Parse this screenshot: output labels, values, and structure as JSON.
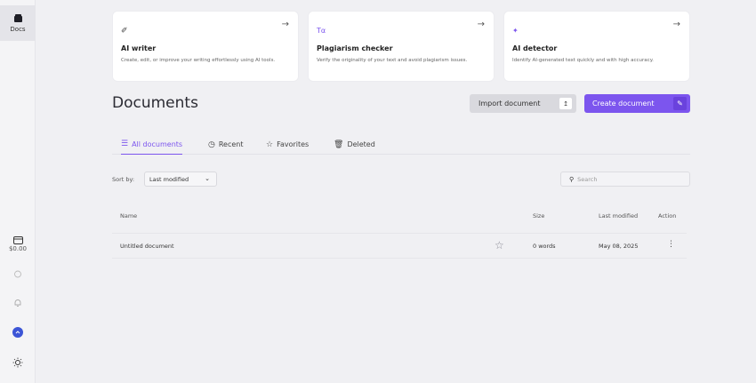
{
  "sidebar": {
    "docs_label": "Docs",
    "credits_label": "$0.00",
    "icons": [
      "folder-icon",
      "wallet-icon",
      "lightbulb-icon",
      "bell-icon",
      "avatar-icon",
      "theme-toggle-icon"
    ]
  },
  "cards": [
    {
      "icon": "✐",
      "title": "AI writer",
      "desc": "Create, edit, or improve your writing effortlessly using AI tools.",
      "arrow": "→"
    },
    {
      "icon": "Tα",
      "title": "Plagiarism checker",
      "desc": "Verify the originality of your text and avoid plagiarism issues.",
      "arrow": "→"
    },
    {
      "icon": "✦",
      "title": "AI detector",
      "desc": "Identify AI-generated text quickly and with high accuracy.",
      "arrow": "→"
    }
  ],
  "page": {
    "title": "Documents",
    "import_label": "Import document",
    "create_label": "Create document"
  },
  "tabs": [
    {
      "icon": "☰",
      "label": "All documents"
    },
    {
      "icon": "◷",
      "label": "Recent"
    },
    {
      "icon": "☆",
      "label": "Favorites"
    },
    {
      "icon": "🗑",
      "label": "Deleted"
    }
  ],
  "filters": {
    "sort_label": "Sort by:",
    "sort_value": "Last modified",
    "search_placeholder": "Search"
  },
  "table": {
    "headers": [
      "Name",
      "Size",
      "Last modified",
      "Action"
    ],
    "rows": [
      {
        "name": "Untitled document",
        "size": "0 words",
        "modified": "May 08, 2025"
      }
    ]
  },
  "colors": {
    "accent": "#7c55ee",
    "background": "#f0f0f3"
  }
}
